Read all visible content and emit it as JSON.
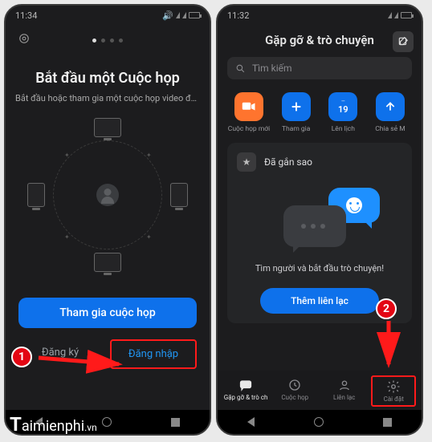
{
  "screen1": {
    "status_time": "11:34",
    "title": "Bắt đầu một Cuộc họp",
    "subtitle": "Bắt đầu hoặc tham gia một cuộc họp video đan...",
    "primary_button": "Tham gia cuộc họp",
    "signup_link": "Đăng ký",
    "signin_link": "Đăng nhập"
  },
  "screen2": {
    "status_time": "11:32",
    "header_title": "Gặp gỡ & trò chuyện",
    "search_placeholder": "Tìm kiếm",
    "actions": {
      "new_meeting": "Cuộc họp mới",
      "join": "Tham gia",
      "schedule": "Lên lịch",
      "share": "Chia sẻ M",
      "schedule_day": "19"
    },
    "card": {
      "title": "Đã gắn sao",
      "message": "Tìm người và bắt đầu trò chuyện!",
      "button": "Thêm liên lạc"
    },
    "tabs": {
      "chat": "Gặp gỡ & trò ch...",
      "meetings": "Cuộc họp",
      "contacts": "Liên lạc",
      "settings": "Cài đặt"
    }
  },
  "callouts": {
    "one": "1",
    "two": "2"
  },
  "watermark": {
    "letter": "T",
    "rest": "aimienphi",
    "suffix": ".vn"
  },
  "colors": {
    "accent": "#0e71eb",
    "orange": "#ff742e",
    "red_callout": "#e30613",
    "red_box": "#ff1a1a"
  }
}
